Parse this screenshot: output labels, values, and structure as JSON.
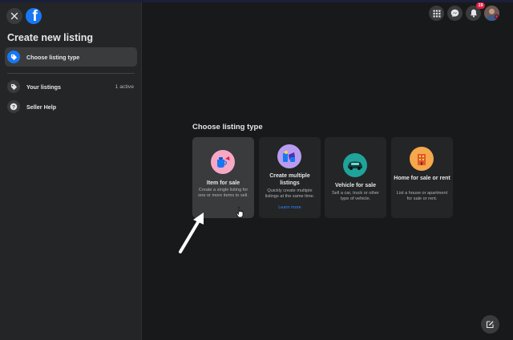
{
  "sidebar": {
    "title": "Create new listing",
    "items": [
      {
        "label": "Choose listing type",
        "icon": "tag-icon",
        "active": true
      },
      {
        "label": "Your listings",
        "count": "1 active",
        "icon": "tag-icon"
      },
      {
        "label": "Seller Help",
        "icon": "question-icon"
      }
    ]
  },
  "topbar": {
    "icons": [
      "menu-grid-icon",
      "messenger-icon",
      "bell-icon"
    ],
    "notification_count": "19"
  },
  "main": {
    "section_title": "Choose listing type",
    "cards": [
      {
        "title": "Item for sale",
        "description": "Create a single listing for one or more items to sell.",
        "icon": "item-sale-icon",
        "icon_color": "#f7a8c4"
      },
      {
        "title": "Create multiple listings",
        "description": "Quickly create multiple listings at the same time.",
        "link": "Learn more",
        "icon": "multiple-listings-icon",
        "icon_color": "#b99cf0"
      },
      {
        "title": "Vehicle for sale",
        "description": "Sell a car, truck or other type of vehicle.",
        "icon": "vehicle-icon",
        "icon_color": "#1fa39a"
      },
      {
        "title": "Home for sale or rent",
        "description": "List a house or apartment for sale or rent.",
        "icon": "home-icon",
        "icon_color": "#f5a84c"
      }
    ]
  },
  "colors": {
    "accent": "#1877f2",
    "background": "#18191a",
    "surface": "#242526",
    "link": "#2d88ff"
  }
}
